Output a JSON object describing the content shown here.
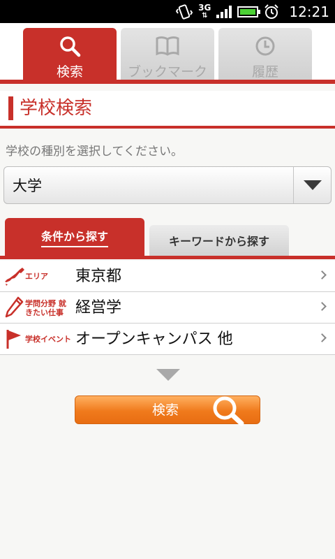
{
  "status_bar": {
    "network": "3G",
    "time": "12:21"
  },
  "tabs": [
    {
      "label": "検索",
      "icon": "search-icon",
      "active": true
    },
    {
      "label": "ブックマーク",
      "icon": "book-icon",
      "active": false
    },
    {
      "label": "履歴",
      "icon": "clock-icon",
      "active": false
    }
  ],
  "title": "学校検索",
  "instruction": "学校の種別を選択してください。",
  "school_type_select": {
    "value": "大学"
  },
  "subtabs": [
    {
      "label": "条件から探す",
      "active": true
    },
    {
      "label": "キーワードから探す",
      "active": false
    }
  ],
  "conditions": [
    {
      "caption": "エリア",
      "value": "東京都",
      "icon": "japan-map-icon"
    },
    {
      "caption": "学問分野 就きたい仕事",
      "value": "経営学",
      "icon": "pencil-icon"
    },
    {
      "caption": "学校イベント",
      "value": "オープンキャンパス 他",
      "icon": "flag-icon"
    }
  ],
  "search_button": {
    "label": "検索"
  },
  "colors": {
    "accent_red": "#c8302a",
    "button_orange": "#f07a1c",
    "inactive_tab": "#d6d6d6"
  }
}
